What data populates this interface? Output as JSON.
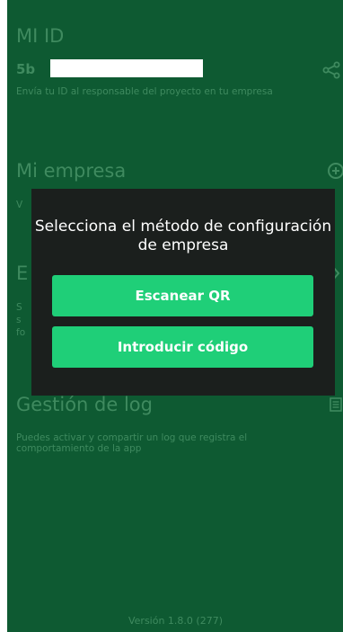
{
  "mi_id": {
    "title": "MI ID",
    "id_prefix": "5b",
    "description": "Envía tu ID al responsable del proyecto en tu empresa"
  },
  "mi_empresa": {
    "title": "Mi empresa",
    "fragment": "V"
  },
  "section3": {
    "title_fragment": "E",
    "lines": [
      "S",
      "s",
      "fo"
    ]
  },
  "log": {
    "title": "Gestión de log",
    "description": "Puedes activar y compartir un log que registra el comportamiento de la app"
  },
  "version": "Versión 1.8.0 (277)",
  "dialog": {
    "title": "Selecciona el método de configuración de empresa",
    "scan_label": "Escanear QR",
    "code_label": "Introducir código"
  },
  "icons": {
    "share": "share-icon",
    "add": "plus-circle-icon",
    "chevron": "chevron-right-icon",
    "log": "document-icon"
  },
  "colors": {
    "background": "#0e5a32",
    "dimmed_text": "#3f8a5f",
    "dialog_bg": "#1b1f1d",
    "accent": "#1fcf78"
  }
}
